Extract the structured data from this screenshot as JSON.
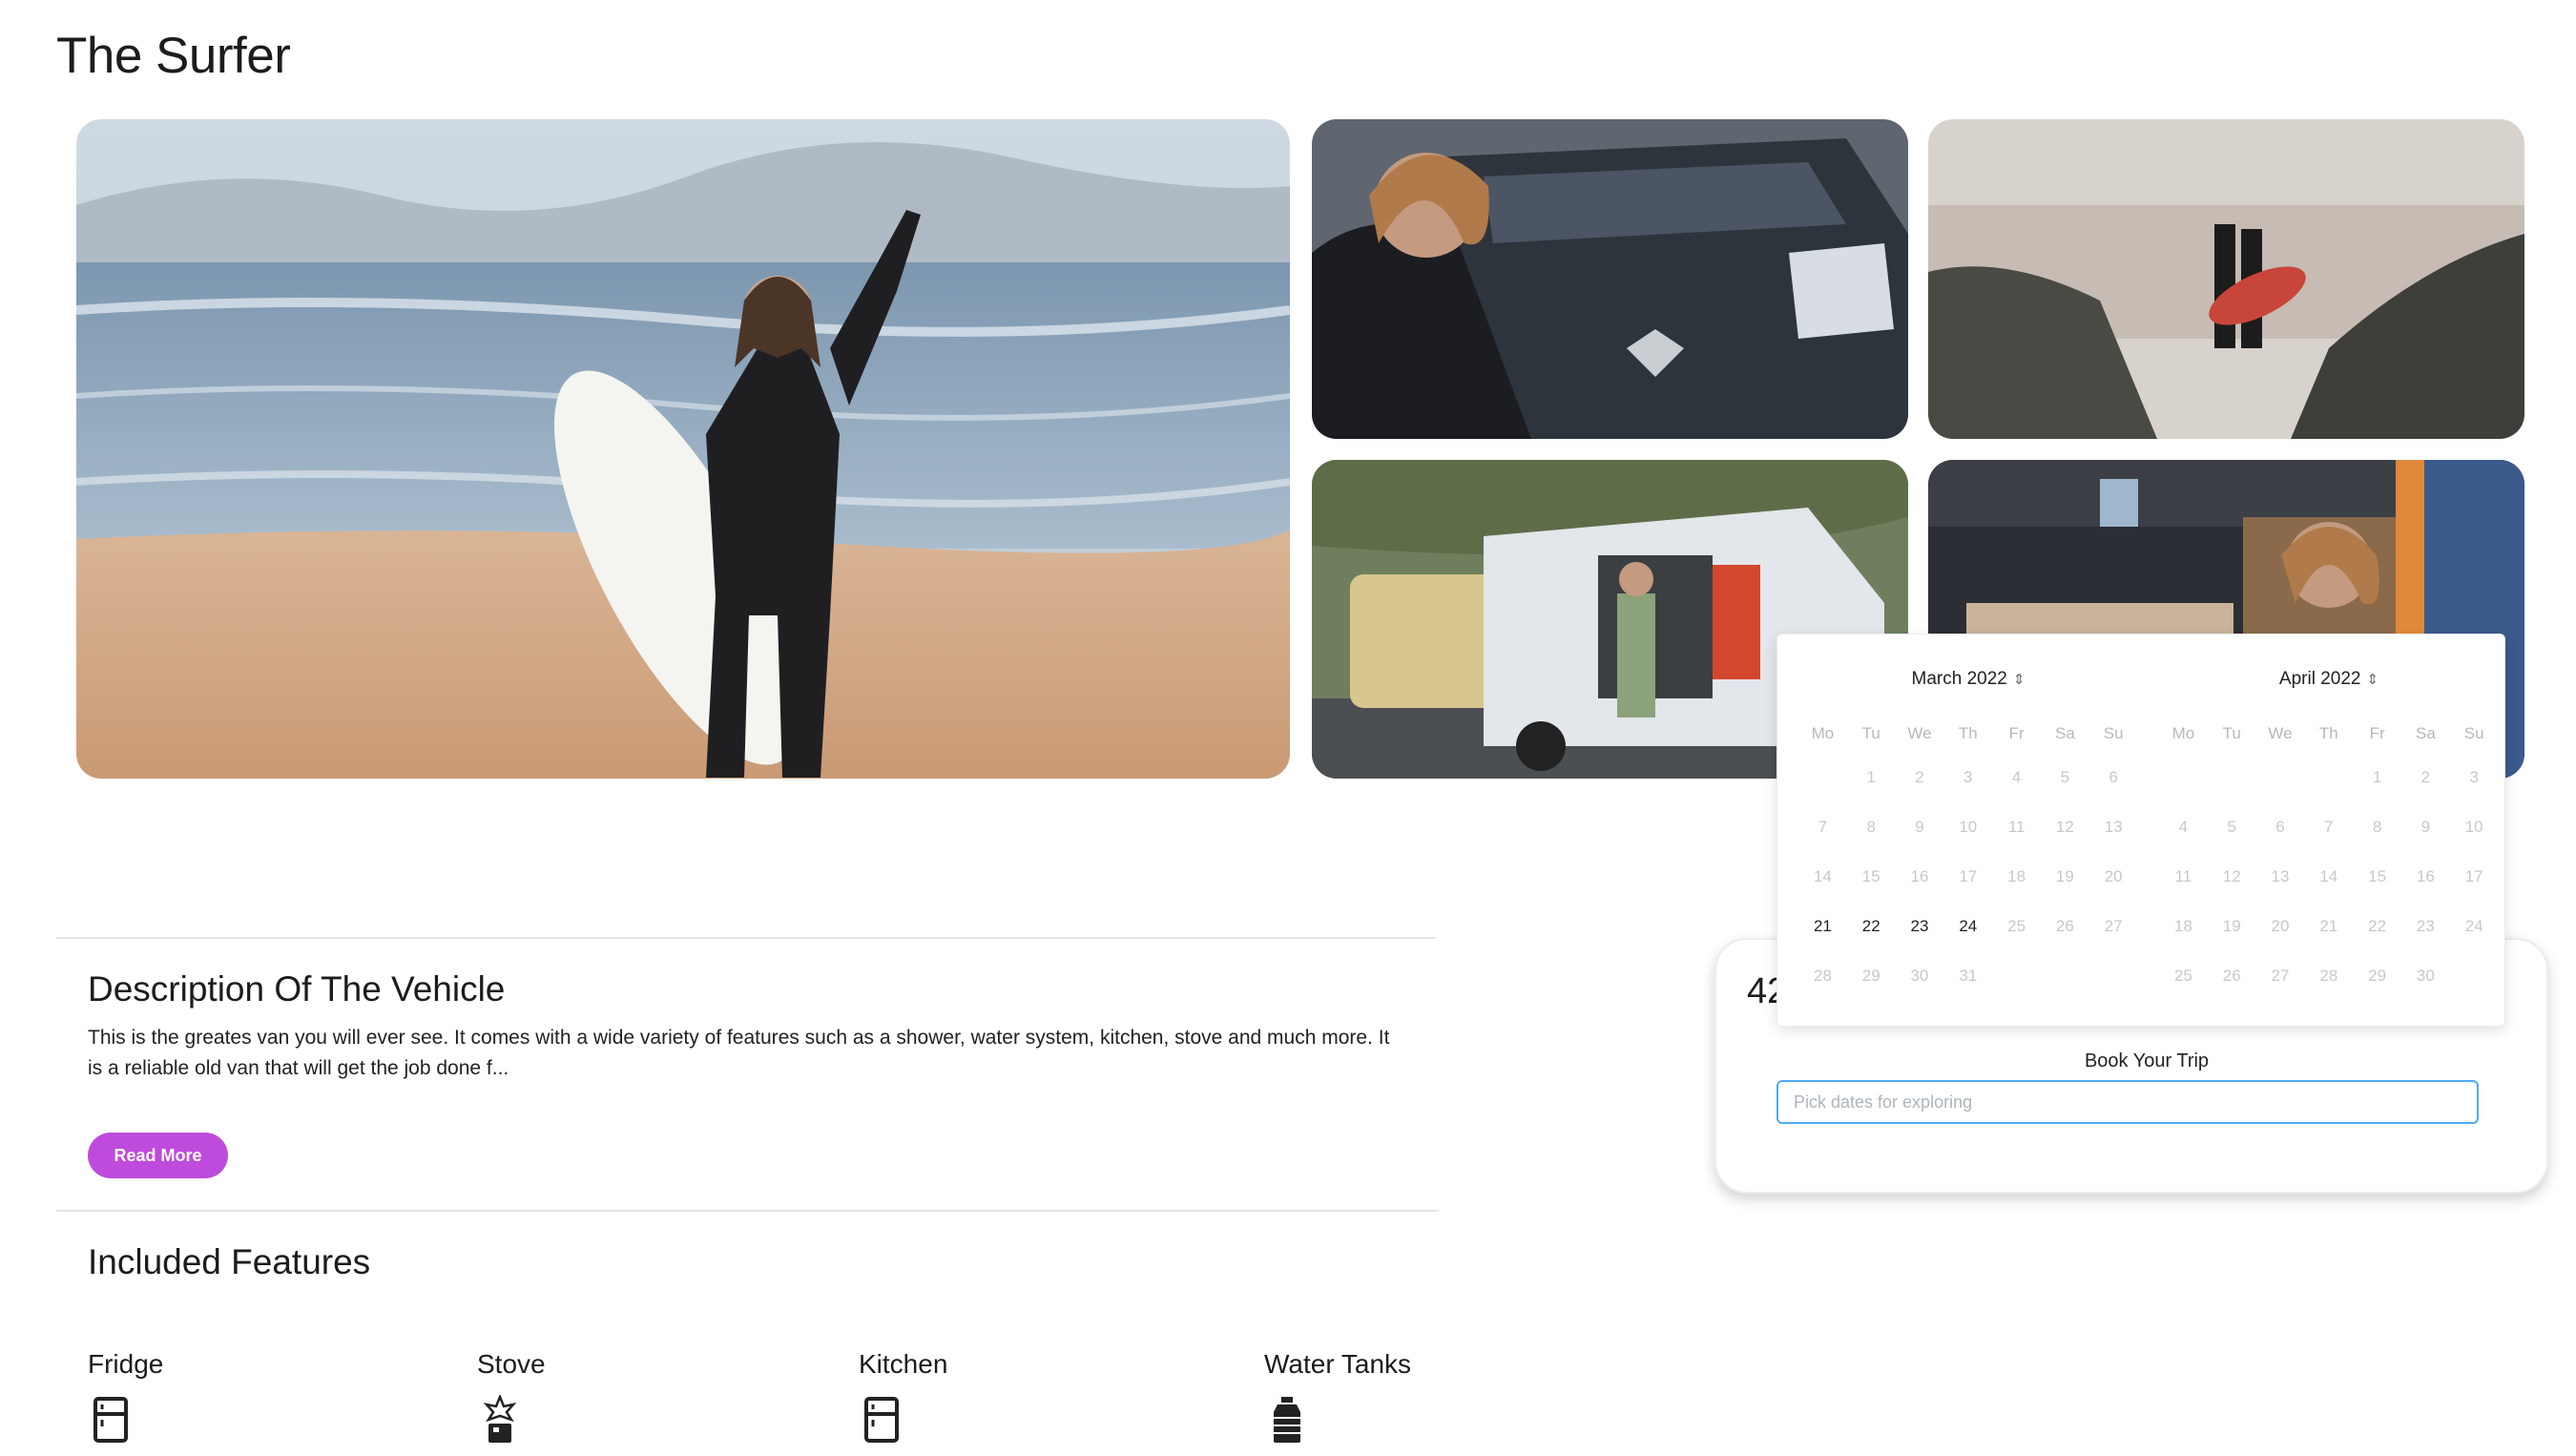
{
  "page": {
    "title": "The Surfer"
  },
  "description": {
    "heading": "Description Of The Vehicle",
    "text": "This is the greates van you will ever see. It comes with a wide variety of features such as a shower, water system, kitchen, stove and much more. It is a reliable old van that will get the job done f...",
    "read_more_label": "Read More"
  },
  "features": {
    "heading": "Included Features",
    "items": [
      {
        "label": "Fridge",
        "icon": "fridge-icon"
      },
      {
        "label": "Stove",
        "icon": "stove-icon"
      },
      {
        "label": "Kitchen",
        "icon": "kitchen-icon"
      },
      {
        "label": "Water Tanks",
        "icon": "water-tank-icon"
      }
    ]
  },
  "booking": {
    "price": "42",
    "label": "Book Your Trip",
    "input_placeholder": "Pick dates for exploring",
    "input_value": ""
  },
  "calendar": {
    "weekdays": [
      "Mo",
      "Tu",
      "We",
      "Th",
      "Fr",
      "Sa",
      "Su"
    ],
    "months": [
      {
        "label": "March 2022",
        "weeks": [
          [
            "",
            "1",
            "2",
            "3",
            "4",
            "5",
            "6"
          ],
          [
            "7",
            "8",
            "9",
            "10",
            "11",
            "12",
            "13"
          ],
          [
            "14",
            "15",
            "16",
            "17",
            "18",
            "19",
            "20"
          ],
          [
            "21",
            "22",
            "23",
            "24",
            "25",
            "26",
            "27"
          ],
          [
            "28",
            "29",
            "30",
            "31",
            "",
            "",
            ""
          ]
        ],
        "selectable_days": [
          "21",
          "22",
          "23",
          "24"
        ]
      },
      {
        "label": "April 2022",
        "weeks": [
          [
            "",
            "",
            "",
            "",
            "1",
            "2",
            "3"
          ],
          [
            "4",
            "5",
            "6",
            "7",
            "8",
            "9",
            "10"
          ],
          [
            "11",
            "12",
            "13",
            "14",
            "15",
            "16",
            "17"
          ],
          [
            "18",
            "19",
            "20",
            "21",
            "22",
            "23",
            "24"
          ],
          [
            "25",
            "26",
            "27",
            "28",
            "29",
            "30",
            ""
          ]
        ],
        "selectable_days": []
      }
    ]
  },
  "gallery": [
    {
      "subject": "surfer-beach-photo"
    },
    {
      "subject": "surfer-van-photo"
    },
    {
      "subject": "surfers-rocks-photo"
    },
    {
      "subject": "camper-van-photo"
    },
    {
      "subject": "van-interior-photo"
    }
  ],
  "colors": {
    "accent": "#be4bdb",
    "input_border": "#4dabf7"
  }
}
